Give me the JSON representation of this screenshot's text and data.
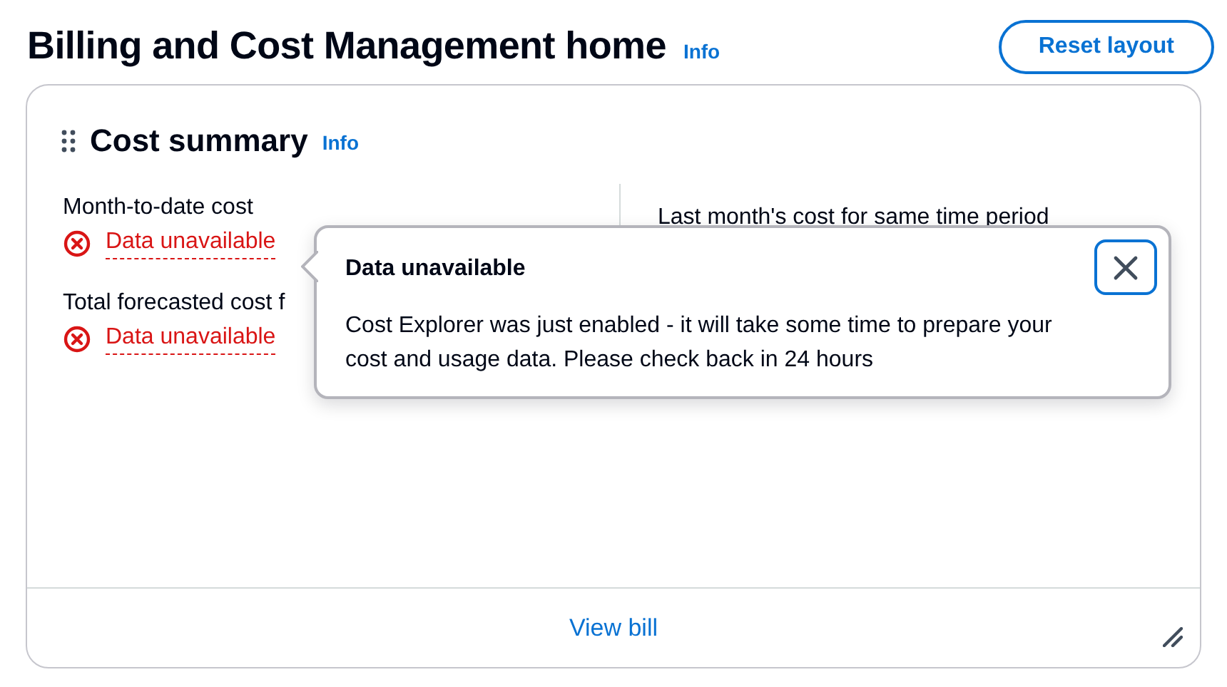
{
  "header": {
    "title": "Billing and Cost Management home",
    "info_link": "Info",
    "reset_button": "Reset layout"
  },
  "card": {
    "title": "Cost summary",
    "info_link": "Info",
    "metrics": [
      {
        "label": "Month-to-date cost",
        "status": "Data unavailable"
      },
      {
        "label": "Total forecasted cost f",
        "status": "Data unavailable"
      }
    ],
    "right_label": "Last month's cost for same time period",
    "footer_link": "View bill"
  },
  "popover": {
    "title": "Data unavailable",
    "body": "Cost Explorer was just enabled - it will take some time to prepare your cost and usage data. Please check back in 24 hours"
  }
}
